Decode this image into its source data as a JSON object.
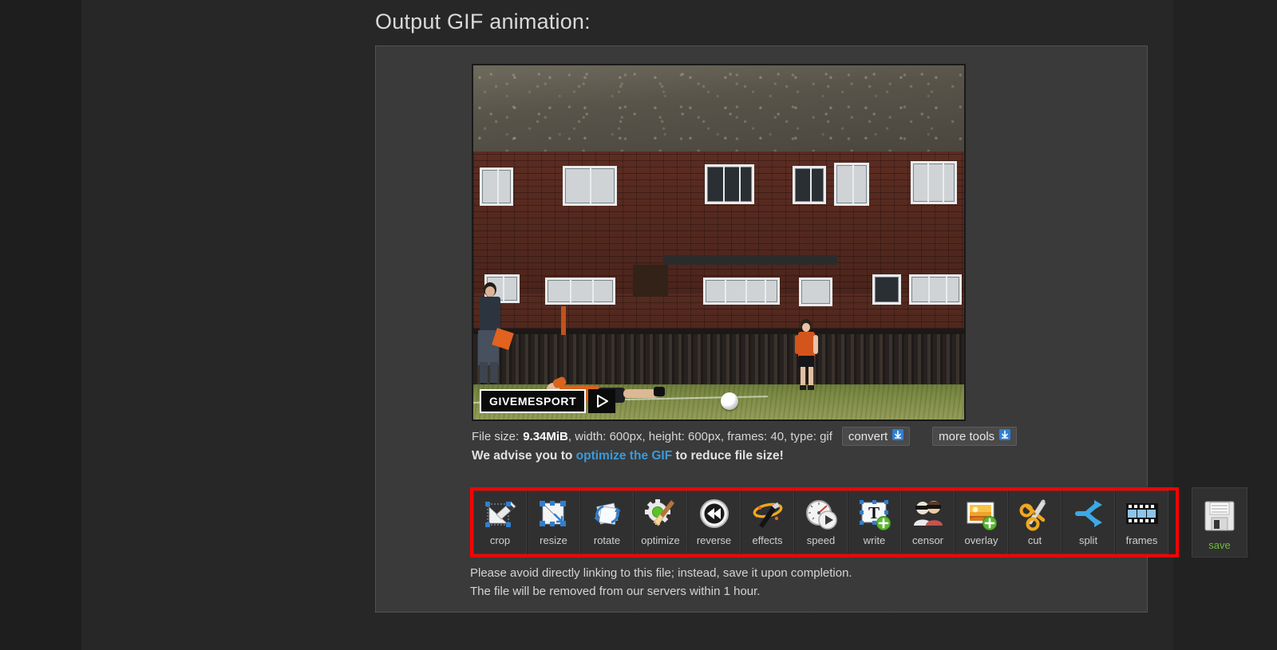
{
  "page": {
    "title": "Output GIF animation:"
  },
  "preview": {
    "watermark_text": "GIVEMESPORT",
    "play_icon": "play-triangle-icon"
  },
  "file_info": {
    "label_size": "File size:",
    "size_value": "9.34MiB",
    "rest": ", width: 600px, height: 600px, frames: 40, type: gif",
    "convert_label": "convert",
    "more_tools_label": "more tools",
    "download_icon": "download-arrow-icon"
  },
  "advise": {
    "prefix": "We advise you to ",
    "link": "optimize the GIF",
    "suffix": " to reduce file size!",
    "link_color": "#3a9ad9"
  },
  "toolbar": {
    "highlight_color": "#ff0000",
    "items": [
      {
        "label": "crop",
        "icon": "crop-icon"
      },
      {
        "label": "resize",
        "icon": "resize-icon"
      },
      {
        "label": "rotate",
        "icon": "rotate-icon"
      },
      {
        "label": "optimize",
        "icon": "optimize-gear-broom-icon"
      },
      {
        "label": "reverse",
        "icon": "rewind-icon"
      },
      {
        "label": "effects",
        "icon": "magic-wand-icon"
      },
      {
        "label": "speed",
        "icon": "speedometer-icon"
      },
      {
        "label": "write",
        "icon": "text-add-icon"
      },
      {
        "label": "censor",
        "icon": "censor-faces-icon"
      },
      {
        "label": "overlay",
        "icon": "image-add-icon"
      },
      {
        "label": "cut",
        "icon": "scissors-icon"
      },
      {
        "label": "split",
        "icon": "split-arrows-icon"
      },
      {
        "label": "frames",
        "icon": "film-strip-icon"
      }
    ],
    "save": {
      "label": "save",
      "icon": "floppy-disk-icon",
      "color": "#6dbb3c"
    }
  },
  "notes": {
    "line1": "Please avoid directly linking to this file; instead, save it upon completion.",
    "line2": "The file will be removed from our servers within 1 hour."
  }
}
